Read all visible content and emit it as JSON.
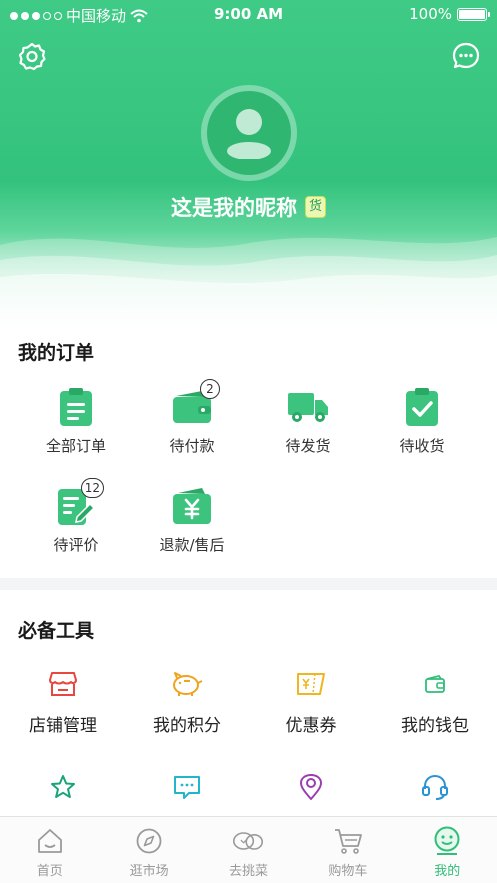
{
  "status_bar": {
    "carrier": "中国移动",
    "time": "9:00 AM",
    "battery": "100%"
  },
  "profile": {
    "nickname": "这是我的昵称",
    "badge": "货"
  },
  "orders": {
    "title": "我的订单",
    "items": [
      {
        "label": "全部订单",
        "icon": "clipboard-icon"
      },
      {
        "label": "待付款",
        "icon": "wallet-icon",
        "count": "2"
      },
      {
        "label": "待发货",
        "icon": "truck-icon"
      },
      {
        "label": "待收货",
        "icon": "clipboard-check-icon"
      },
      {
        "label": "待评价",
        "icon": "edit-note-icon",
        "count": "12"
      },
      {
        "label": "退款/售后",
        "icon": "refund-wallet-icon"
      }
    ]
  },
  "tools": {
    "title": "必备工具",
    "items": [
      {
        "label": "店铺管理",
        "icon": "store-icon",
        "color": "#e8473f"
      },
      {
        "label": "我的积分",
        "icon": "piggy-bank-icon",
        "color": "#f0a31e"
      },
      {
        "label": "优惠券",
        "icon": "coupon-icon",
        "color": "#f0b622"
      },
      {
        "label": "我的钱包",
        "icon": "wallet-icon",
        "color": "#2fbf78"
      },
      {
        "icon": "star-icon",
        "color": "#1aa37a"
      },
      {
        "icon": "message-icon",
        "color": "#22b6c8"
      },
      {
        "icon": "location-icon",
        "color": "#9b3fb0"
      },
      {
        "icon": "headset-icon",
        "color": "#2a93d5"
      }
    ]
  },
  "tabbar": {
    "items": [
      {
        "label": "首页",
        "icon": "home-icon"
      },
      {
        "label": "逛市场",
        "icon": "compass-icon"
      },
      {
        "label": "去挑菜",
        "icon": "vegetable-icon"
      },
      {
        "label": "购物车",
        "icon": "cart-icon"
      },
      {
        "label": "我的",
        "icon": "smiley-icon",
        "active": true
      }
    ]
  },
  "colors": {
    "brand": "#2fbf78",
    "inactive": "#9a9a9a"
  }
}
